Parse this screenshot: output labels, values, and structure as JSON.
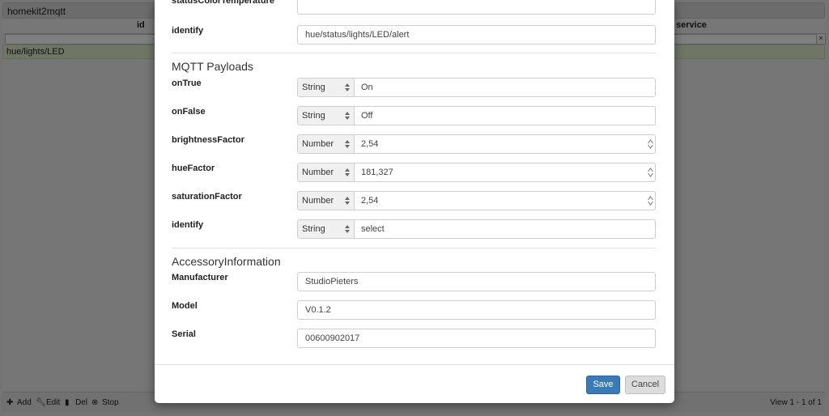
{
  "grid": {
    "title": "homekit2mqtt",
    "col_id": "id",
    "col_service": "service",
    "filter_clear": "×",
    "row_id": "hue/lights/LED",
    "pager": {
      "add": "Add",
      "edit": "Edit",
      "del": "Del",
      "stop": "Stop",
      "add_icon": "plus-icon",
      "edit_icon": "wrench-icon",
      "del_icon": "trash-icon",
      "stop_icon": "stop-icon"
    },
    "view_info": "View 1 - 1 of 1"
  },
  "form": {
    "status_color_temperature": {
      "label": "statusColorTemperature",
      "value": ""
    },
    "identify_topic": {
      "label": "identify",
      "value": "hue/status/lights/LED/alert"
    },
    "mqtt_payloads": {
      "title": "MQTT Payloads",
      "on_true": {
        "label": "onTrue",
        "type": "String",
        "value": "On"
      },
      "on_false": {
        "label": "onFalse",
        "type": "String",
        "value": "Off"
      },
      "brightness_factor": {
        "label": "brightnessFactor",
        "type": "Number",
        "value": "2,54"
      },
      "hue_factor": {
        "label": "hueFactor",
        "type": "Number",
        "value": "181,327"
      },
      "saturation_factor": {
        "label": "saturationFactor",
        "type": "Number",
        "value": "2,54"
      },
      "identify": {
        "label": "identify",
        "type": "String",
        "value": "select"
      }
    },
    "accessory_information": {
      "title": "AccessoryInformation",
      "manufacturer": {
        "label": "Manufacturer",
        "value": "StudioPieters"
      },
      "model": {
        "label": "Model",
        "value": "V0.1.2"
      },
      "serial": {
        "label": "Serial",
        "value": "00600902017"
      }
    }
  },
  "buttons": {
    "save": "Save",
    "cancel": "Cancel"
  },
  "colors": {
    "primary": "#3a7ab8",
    "row_selected": "#dfeccd",
    "overlay": "rgba(0,0,0,0.5)"
  }
}
